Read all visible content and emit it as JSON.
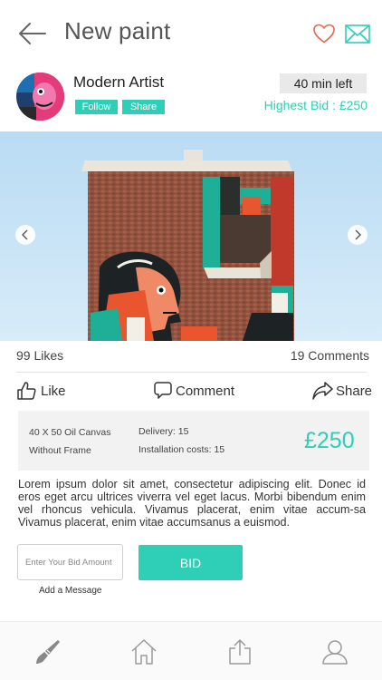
{
  "header": {
    "title": "New paint"
  },
  "artist": {
    "name": "Modern Artist",
    "follow_label": "Follow",
    "share_label": "Share",
    "time_left": "40 min left",
    "highest_bid": "Highest Bid : £250"
  },
  "stats": {
    "likes": "99 Likes",
    "comments": "19 Comments"
  },
  "actions": {
    "like": "Like",
    "comment": "Comment",
    "share": "Share"
  },
  "details": {
    "size": "40 X 50 Oil Canvas",
    "frame": "Without Frame",
    "delivery": "Delivery: 15",
    "installation": "Installation costs: 15",
    "price": "£250"
  },
  "description": "Lorem ipsum dolor sit amet, consectetur adipiscing elit. Donec id eros eget arcu ultrices viverra vel eget lacus. Morbi bibendum enim vel rhoncus vehicula. Vivamus placerat, enim vitae accum-sa Vivamus placerat, enim vitae accumsanus a euismod.",
  "bid": {
    "placeholder": "Enter Your Bid Amount",
    "button_label": "BID",
    "add_message": "Add a Message"
  },
  "tabbar": {
    "items": [
      "brush-icon",
      "home-icon",
      "share-upload-icon",
      "profile-icon"
    ]
  },
  "colors": {
    "accent": "#2ecfb6",
    "heart": "#e9664e"
  }
}
